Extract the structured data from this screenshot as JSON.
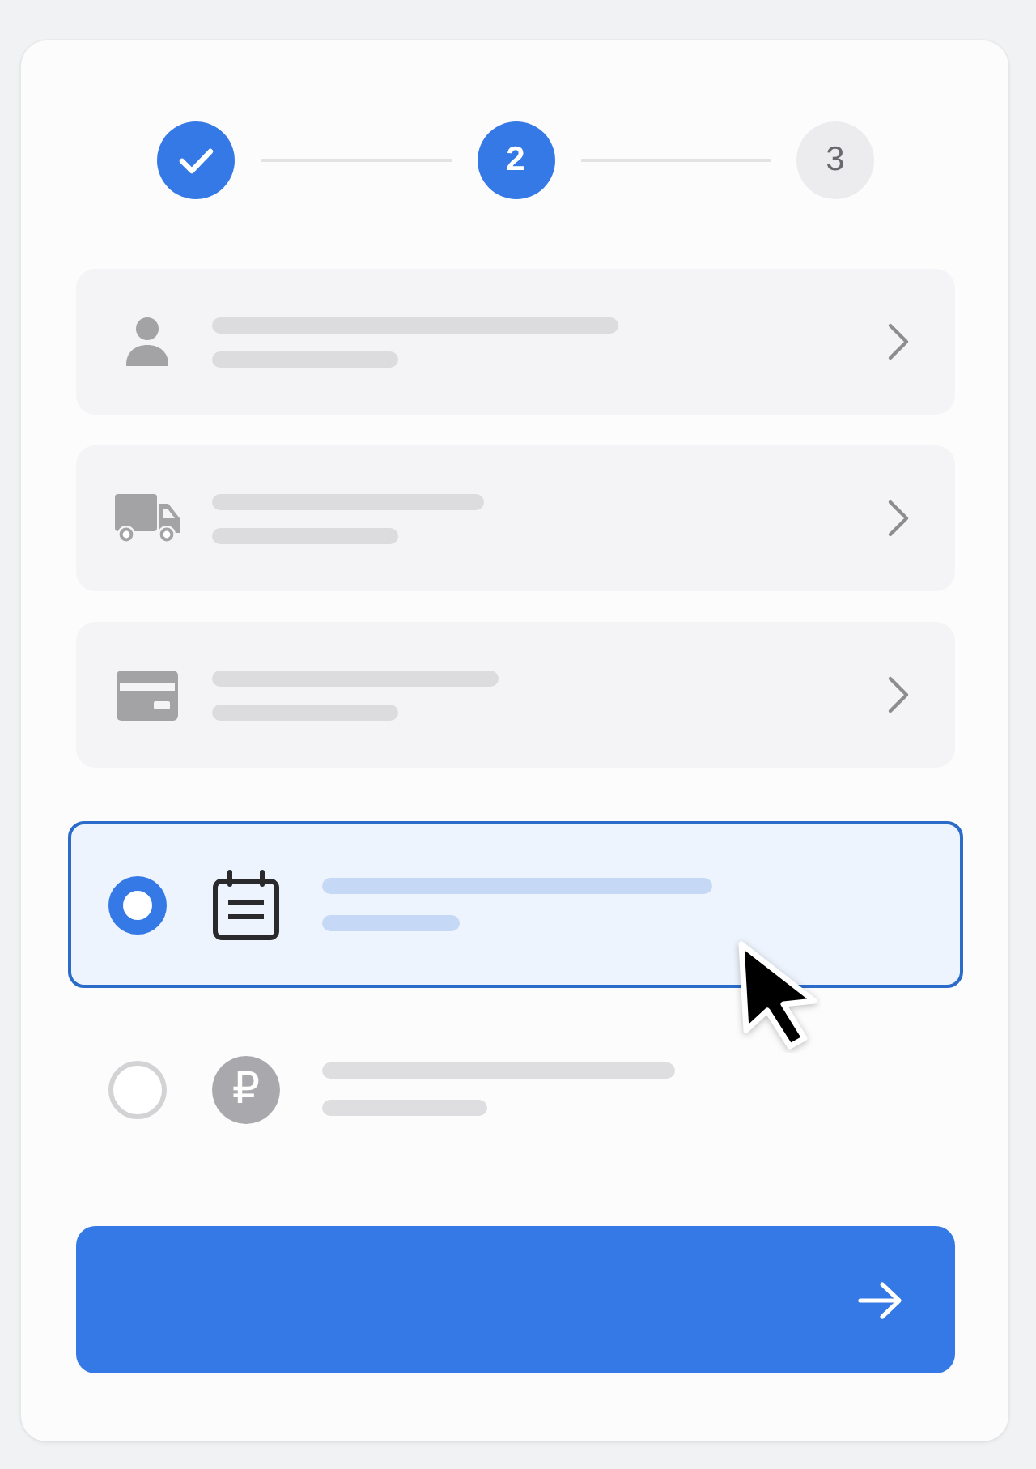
{
  "stepper": {
    "steps": [
      {
        "completed": true,
        "selected": false
      },
      {
        "number": "2",
        "completed": false,
        "selected": true
      },
      {
        "number": "3",
        "completed": false,
        "selected": false
      }
    ]
  },
  "summary_rows": [
    {
      "kind": "person"
    },
    {
      "kind": "truck"
    },
    {
      "kind": "card"
    }
  ],
  "options": [
    {
      "kind": "calendar",
      "selected": true
    },
    {
      "kind": "currency",
      "symbol": "₽",
      "selected": false
    }
  ],
  "next_button": {
    "kind": "arrow"
  },
  "cursor": {
    "kind": "arrow"
  }
}
